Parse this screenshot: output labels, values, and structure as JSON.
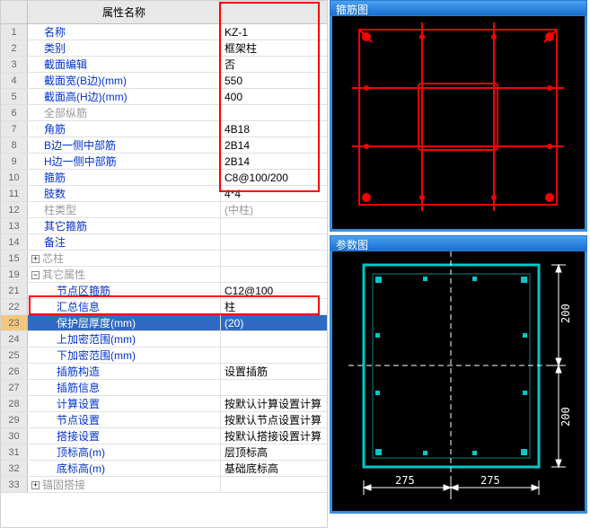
{
  "header": {
    "num": "",
    "name": "属性名称",
    "val": ""
  },
  "rows": [
    {
      "n": "1",
      "name": "名称",
      "val": "KZ-1",
      "cls": ""
    },
    {
      "n": "2",
      "name": "类别",
      "val": "框架柱",
      "cls": ""
    },
    {
      "n": "3",
      "name": "截面编辑",
      "val": "否",
      "cls": ""
    },
    {
      "n": "4",
      "name": "截面宽(B边)(mm)",
      "val": "550",
      "cls": ""
    },
    {
      "n": "5",
      "name": "截面高(H边)(mm)",
      "val": "400",
      "cls": ""
    },
    {
      "n": "6",
      "name": "全部纵筋",
      "val": "",
      "cls": "gray"
    },
    {
      "n": "7",
      "name": "角筋",
      "val": "4B18",
      "cls": ""
    },
    {
      "n": "8",
      "name": "B边一侧中部筋",
      "val": "2B14",
      "cls": ""
    },
    {
      "n": "9",
      "name": "H边一侧中部筋",
      "val": "2B14",
      "cls": ""
    },
    {
      "n": "10",
      "name": "箍筋",
      "val": "C8@100/200",
      "cls": ""
    },
    {
      "n": "11",
      "name": "肢数",
      "val": "4*4",
      "cls": ""
    },
    {
      "n": "12",
      "name": "柱类型",
      "val": "(中柱)",
      "cls": "gray"
    },
    {
      "n": "13",
      "name": "其它箍筋",
      "val": "",
      "cls": ""
    },
    {
      "n": "14",
      "name": "备注",
      "val": "",
      "cls": ""
    },
    {
      "n": "15",
      "name": "芯柱",
      "val": "",
      "cls": "gray",
      "toggle": "+"
    },
    {
      "n": "19",
      "name": "其它属性",
      "val": "",
      "cls": "gray",
      "toggle": "−"
    },
    {
      "n": "21",
      "name": "节点区箍筋",
      "val": "C12@100",
      "cls": "indent"
    },
    {
      "n": "22",
      "name": "汇总信息",
      "val": "柱",
      "cls": "indent"
    },
    {
      "n": "23",
      "name": "保护层厚度(mm)",
      "val": "(20)",
      "cls": "indent selected hl"
    },
    {
      "n": "24",
      "name": "上加密范围(mm)",
      "val": "",
      "cls": "indent"
    },
    {
      "n": "25",
      "name": "下加密范围(mm)",
      "val": "",
      "cls": "indent"
    },
    {
      "n": "26",
      "name": "插筋构造",
      "val": "设置插筋",
      "cls": "indent"
    },
    {
      "n": "27",
      "name": "插筋信息",
      "val": "",
      "cls": "indent"
    },
    {
      "n": "28",
      "name": "计算设置",
      "val": "按默认计算设置计算",
      "cls": "indent"
    },
    {
      "n": "29",
      "name": "节点设置",
      "val": "按默认节点设置计算",
      "cls": "indent"
    },
    {
      "n": "30",
      "name": "搭接设置",
      "val": "按默认搭接设置计算",
      "cls": "indent"
    },
    {
      "n": "31",
      "name": "顶标高(m)",
      "val": "层顶标高",
      "cls": "indent"
    },
    {
      "n": "32",
      "name": "底标高(m)",
      "val": "基础底标高",
      "cls": "indent"
    },
    {
      "n": "33",
      "name": "锚固搭接",
      "val": "",
      "cls": "gray",
      "toggle": "+"
    }
  ],
  "diagrams": {
    "d1_title": "箍筋图",
    "d2_title": "参数图",
    "d2_dim_h": "275",
    "d2_dim_h2": "275",
    "d2_dim_v": "200",
    "d2_dim_v2": "200"
  },
  "chart_data": {
    "type": "table",
    "title": "柱属性",
    "rows": [
      [
        "名称",
        "KZ-1"
      ],
      [
        "类别",
        "框架柱"
      ],
      [
        "截面编辑",
        "否"
      ],
      [
        "截面宽(B边)(mm)",
        "550"
      ],
      [
        "截面高(H边)(mm)",
        "400"
      ],
      [
        "角筋",
        "4B18"
      ],
      [
        "B边一侧中部筋",
        "2B14"
      ],
      [
        "H边一侧中部筋",
        "2B14"
      ],
      [
        "箍筋",
        "C8@100/200"
      ],
      [
        "肢数",
        "4*4"
      ],
      [
        "柱类型",
        "(中柱)"
      ],
      [
        "节点区箍筋",
        "C12@100"
      ],
      [
        "保护层厚度(mm)",
        "(20)"
      ],
      [
        "插筋构造",
        "设置插筋"
      ],
      [
        "计算设置",
        "按默认计算设置计算"
      ],
      [
        "节点设置",
        "按默认节点设置计算"
      ],
      [
        "搭接设置",
        "按默认搭接设置计算"
      ],
      [
        "顶标高(m)",
        "层顶标高"
      ],
      [
        "底标高(m)",
        "基础底标高"
      ]
    ]
  }
}
